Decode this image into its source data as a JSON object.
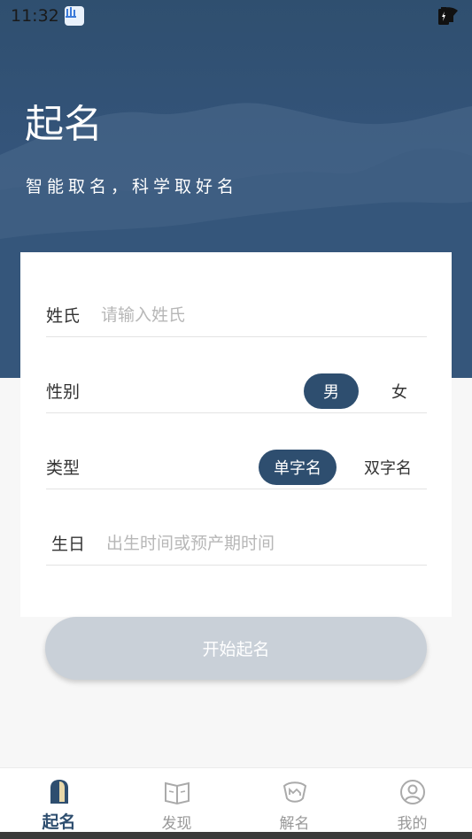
{
  "status_bar": {
    "time": "11:32"
  },
  "hero": {
    "title": "起名",
    "subtitle": "智能取名，科学取好名"
  },
  "form": {
    "surname": {
      "label": "姓氏",
      "placeholder": "请输入姓氏",
      "value": ""
    },
    "gender": {
      "label": "性别",
      "options": [
        "男",
        "女"
      ],
      "selected": "男"
    },
    "type": {
      "label": "类型",
      "options": [
        "单字名",
        "双字名"
      ],
      "selected": "单字名"
    },
    "birth": {
      "label": "生日",
      "placeholder": "出生时间或预产期时间",
      "value": ""
    }
  },
  "start_button": {
    "label": "开始起名"
  },
  "bottom_nav": {
    "items": [
      {
        "label": "起名",
        "icon": "naming-icon",
        "active": true
      },
      {
        "label": "发现",
        "icon": "book-icon",
        "active": false
      },
      {
        "label": "解名",
        "icon": "name-analysis-icon",
        "active": false
      },
      {
        "label": "我的",
        "icon": "profile-icon",
        "active": false
      }
    ]
  },
  "colors": {
    "primary": "#2e4e6f",
    "button_disabled": "#c9d0d8",
    "background": "#f7f7f7"
  }
}
